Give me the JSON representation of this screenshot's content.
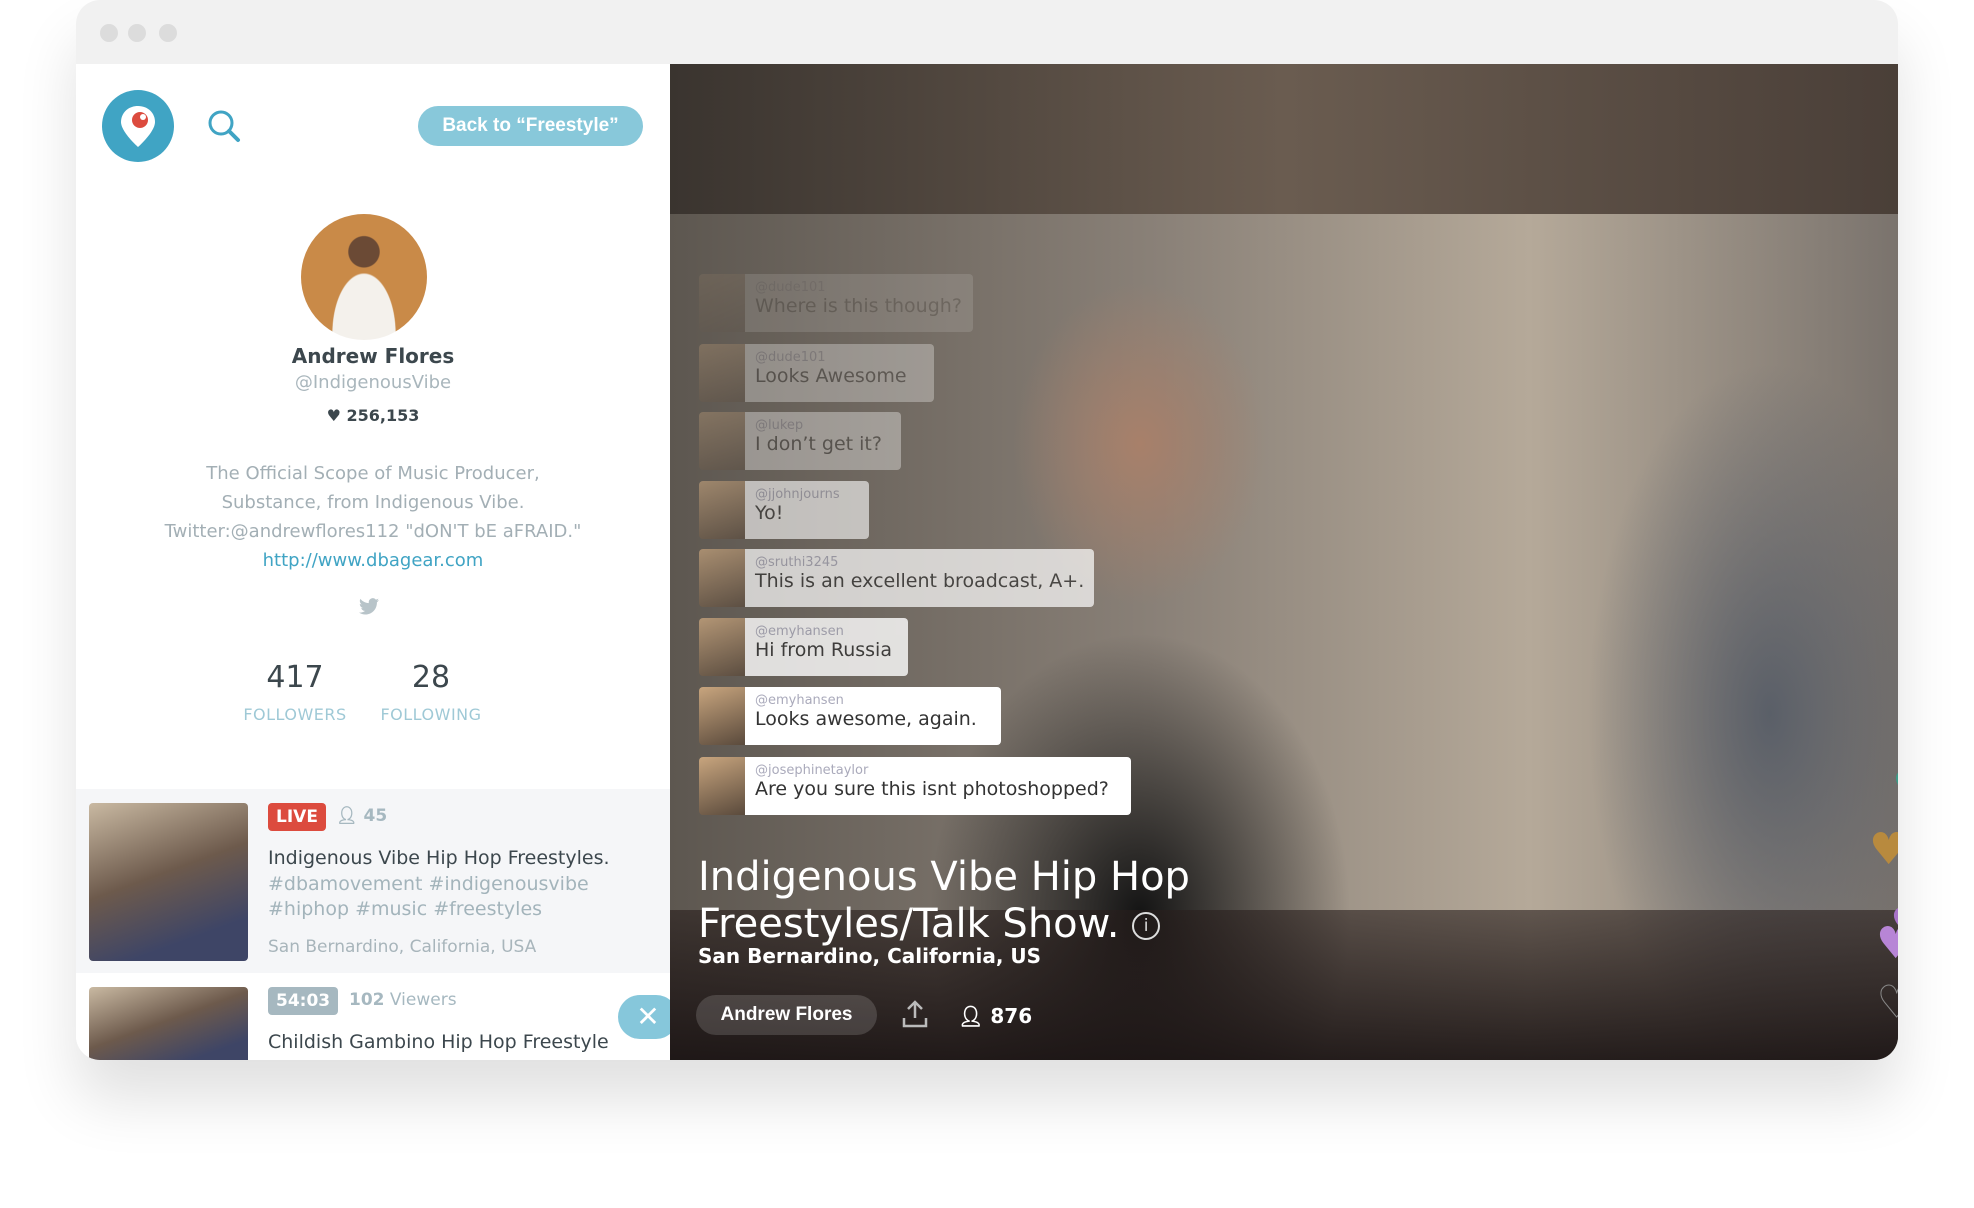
{
  "header": {
    "back_label": "Back to “Freestyle”"
  },
  "profile": {
    "name": "Andrew Flores",
    "handle": "@IndigenousVibe",
    "hearts": "256,153",
    "bio": [
      "The Official Scope of Music Producer,",
      "Substance, from Indigenous Vibe.",
      "Twitter:@andrewflores112 \"dON'T bE aFRAID.\""
    ],
    "link": "http://www.dbagear.com",
    "followers": "417",
    "followers_label": "FOLLOWERS",
    "following": "28",
    "following_label": "FOLLOWING"
  },
  "broadcasts": [
    {
      "badge": "LIVE",
      "badge_color": "#dc4b3e",
      "viewers": "45",
      "title": "Indigenous Vibe Hip Hop Freestyles.",
      "tags": [
        "#dbamovement #indigenousvibe",
        "#hiphop #music #freestyles"
      ],
      "location": "San Bernardino, California, USA"
    },
    {
      "badge": "54:03",
      "badge_color": "#a6b8c0",
      "viewers": "102",
      "viewers_suffix": "Viewers",
      "title": "Childish Gambino Hip Hop Freestyle"
    }
  ],
  "chat": [
    {
      "user": "@dude101",
      "message": "Where is this though?"
    },
    {
      "user": "@dude101",
      "message": "Looks Awesome"
    },
    {
      "user": "@lukep",
      "message": "I don’t get it?"
    },
    {
      "user": "@jjohnjourns",
      "message": "Yo!"
    },
    {
      "user": "@sruthi3245",
      "message": "This is an excellent broadcast, A+."
    },
    {
      "user": "@emyhansen",
      "message": "Hi from Russia"
    },
    {
      "user": "@emyhansen",
      "message": "Looks awesome, again."
    },
    {
      "user": "@josephinetaylor",
      "message": "Are you sure this isnt photoshopped?"
    }
  ],
  "broadcast": {
    "title_line1": "Indigenous Vibe Hip Hop",
    "title_line2": "Freestyles/Talk Show.",
    "location": "San Bernardino, California, US",
    "broadcaster": "Andrew Flores",
    "viewers": "876"
  },
  "colors": {
    "accent": "#40a4c4",
    "live": "#dc4b3e",
    "hearts": [
      "#3d9a86",
      "#b88a3e",
      "#a873c8",
      "#a873c8"
    ]
  }
}
